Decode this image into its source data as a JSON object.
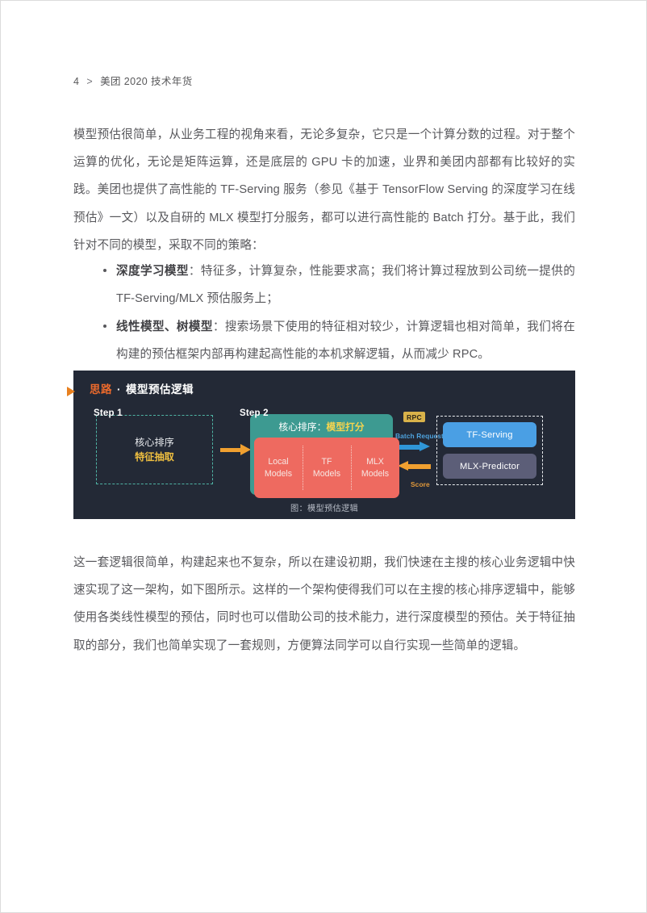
{
  "page": {
    "number": "4",
    "separator": ">",
    "running_title": "美团 2020 技术年货"
  },
  "body": {
    "paragraph_1": "模型预估很简单，从业务工程的视角来看，无论多复杂，它只是一个计算分数的过程。对于整个运算的优化，无论是矩阵运算，还是底层的 GPU 卡的加速，业界和美团内部都有比较好的实践。美团也提供了高性能的 TF-Serving 服务（参见《基于 TensorFlow Serving 的深度学习在线预估》一文）以及自研的 MLX 模型打分服务，都可以进行高性能的 Batch 打分。基于此，我们针对不同的模型，采取不同的策略：",
    "bullets": [
      {
        "term": "深度学习模型",
        "text": "：特征多，计算复杂，性能要求高；我们将计算过程放到公司统一提供的 TF-Serving/MLX 预估服务上；"
      },
      {
        "term": "线性模型、树模型",
        "text": "：搜索场景下使用的特征相对较少，计算逻辑也相对简单，我们将在构建的预估框架内部再构建起高性能的本机求解逻辑，从而减少 RPC。"
      }
    ],
    "paragraph_2": "这一套逻辑很简单，构建起来也不复杂，所以在建设初期，我们快速在主搜的核心业务逻辑中快速实现了这一架构，如下图所示。这样的一个架构使得我们可以在主搜的核心排序逻辑中，能够使用各类线性模型的预估，同时也可以借助公司的技术能力，进行深度模型的预估。关于特征抽取的部分，我们也简单实现了一套规则，方便算法同学可以自行实现一些简单的逻辑。"
  },
  "figure": {
    "title_highlight": "思路",
    "title_dot": "·",
    "title_rest": "模型预估逻辑",
    "caption": "图：模型预估逻辑",
    "step1": {
      "label": "Step 1",
      "line1": "核心排序",
      "line2": "特征抽取"
    },
    "step2": {
      "label": "Step 2",
      "title_prefix": "核心排序：",
      "title_highlight": "模型打分",
      "models": [
        {
          "line1": "Local",
          "line2": "Models"
        },
        {
          "line1": "TF",
          "line2": "Models"
        },
        {
          "line1": "MLX",
          "line2": "Models"
        }
      ]
    },
    "rpc": {
      "badge": "RPC",
      "request_label": "Batch Request",
      "response_label": "Score"
    },
    "serving": [
      {
        "name": "TF-Serving"
      },
      {
        "name": "MLX-Predictor"
      }
    ],
    "colors": {
      "panel_bg": "#232936",
      "accent_orange": "#ec6a2c",
      "teal": "#3d9a91",
      "salmon": "#ee6a60",
      "gold": "#f0c040",
      "blue": "#4a9fe4",
      "purple": "#5c5e78",
      "arrow_orange": "#f0a030",
      "arrow_blue": "#2f96d8",
      "dashed_teal": "#4fb3a4",
      "rpc_badge": "#d9b24a"
    }
  }
}
